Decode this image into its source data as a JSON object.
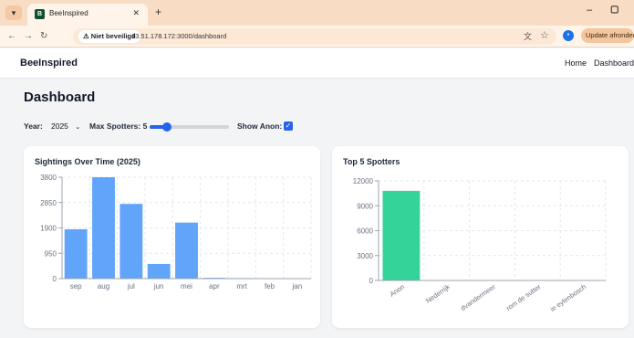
{
  "browser": {
    "tab_title": "BeeInspired",
    "security_label": "⚠ Niet beveiligd",
    "url": "13.51.178.172:3000/dashboard",
    "update_label": "Update afronden"
  },
  "navbar": {
    "brand": "BeeInspired",
    "links": [
      "Home",
      "Dashboard"
    ]
  },
  "page": {
    "title": "Dashboard",
    "filters": {
      "year_label": "Year:",
      "year_value": "2025",
      "max_spotters_label": "Max Spotters: 5",
      "max_spotters_value": 5,
      "max_spotters_fraction": 0.22,
      "show_anon_label": "Show Anon:",
      "show_anon_checked": true
    }
  },
  "colors": {
    "blue_bar": "#60a5fa",
    "green_bar": "#34d399",
    "accent": "#2563eb"
  },
  "chart_data": [
    {
      "type": "bar",
      "title": "Sightings Over Time (2025)",
      "categories": [
        "sep",
        "aug",
        "jul",
        "jun",
        "mei",
        "apr",
        "mrt",
        "feb",
        "jan"
      ],
      "values": [
        1850,
        3800,
        2800,
        550,
        2100,
        30,
        20,
        10,
        5
      ],
      "yticks": [
        0,
        950,
        1900,
        2850,
        3800
      ],
      "ylim": [
        0,
        3800
      ],
      "grid": true,
      "color": "#60a5fa"
    },
    {
      "type": "bar",
      "title": "Top 5 Spotters",
      "categories": [
        "Anon",
        "Nederrijk",
        "dvandermeer",
        "rom de sutter",
        "ie eylenbosch"
      ],
      "values": [
        10800,
        40,
        30,
        25,
        20
      ],
      "yticks": [
        0,
        3000,
        6000,
        9000,
        12000
      ],
      "ylim": [
        0,
        12000
      ],
      "grid": true,
      "color": "#34d399"
    }
  ]
}
